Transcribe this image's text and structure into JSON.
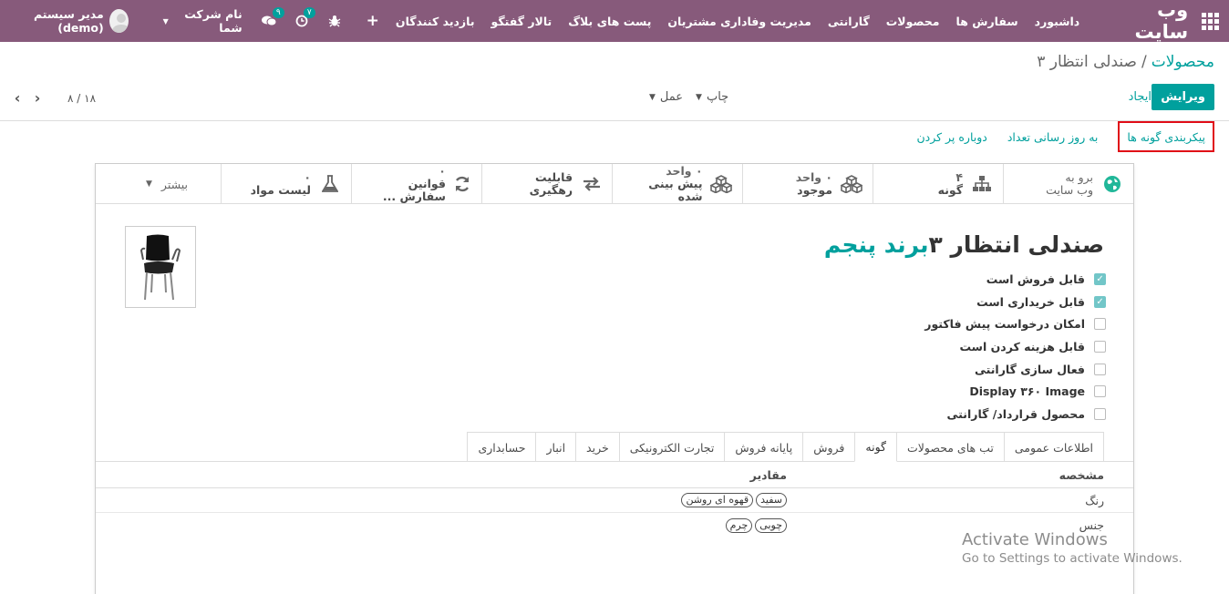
{
  "navbar": {
    "brand": "وب سایت",
    "menu": [
      "داشبورد",
      "سفارش ها",
      "محصولات",
      "گارانتی",
      "مدیریت وفاداری مشتریان",
      "پست های بلاگ",
      "تالار گفتگو",
      "بازدید کنندگان"
    ],
    "plus": "+",
    "activity_badge": "۷",
    "messages_badge": "۹",
    "company": "نام شرکت شما",
    "user": "مدیر سیستم (demo)",
    "colors": {
      "bar": "#875a7b",
      "badge": "#00a09d"
    }
  },
  "breadcrumb": {
    "parent": "محصولات",
    "separator": "/",
    "current": "صندلی انتظار ۳"
  },
  "control": {
    "edit": "ویرایش",
    "create": "ایجاد",
    "print": "چاپ",
    "action": "عمل",
    "pager_value": "۸ / ۱۸"
  },
  "statusbar": {
    "configure_variants": "پیکربندی گونه ها",
    "update_qty": "به روز رسانی تعداد",
    "replenish": "دوباره پر کردن"
  },
  "smart_buttons": {
    "website": {
      "line1": "برو به",
      "line2": "وب سایت",
      "icon": "globe-icon"
    },
    "variants": {
      "num": "۴",
      "label": "گونه",
      "icon": "sitemap-icon"
    },
    "on_hand": {
      "num": "۰ واحد",
      "label": "موجود",
      "icon": "cubes-icon"
    },
    "forecasted": {
      "num": "۰ واحد",
      "label": "پیش بینی شده",
      "icon": "cubes-icon"
    },
    "traceability": {
      "label": "قابلیت رهگیری",
      "icon": "exchange-icon"
    },
    "reordering": {
      "num": "۰",
      "label": "قوانین سفارش ...",
      "icon": "refresh-icon"
    },
    "bom": {
      "num": "۰",
      "label": "لیست مواد",
      "icon": "flask-icon"
    },
    "more": "بیشتر"
  },
  "product": {
    "name": "صندلی انتظار ۳",
    "brand": "برند پنجم",
    "image": "chair-image"
  },
  "checkboxes": [
    {
      "label": "قابل فروش است",
      "checked": true
    },
    {
      "label": "قابل خریداری است",
      "checked": true
    },
    {
      "label": "امکان درخواست پیش فاکتور",
      "checked": false
    },
    {
      "label": "قابل هزینه کردن است",
      "checked": false
    },
    {
      "label": "فعال سازی گارانتی",
      "checked": false
    },
    {
      "label": "Display ۳۶۰ Image",
      "checked": false
    },
    {
      "label": "محصول قرارداد/ گارانتی",
      "checked": false
    }
  ],
  "tabs": [
    "اطلاعات عمومی",
    "تب های محصولات",
    "گونه",
    "فروش",
    "پایانه فروش",
    "تجارت الکترونیکی",
    "خرید",
    "انبار",
    "حسابداری"
  ],
  "active_tab": "گونه",
  "attributes": {
    "header_attr": "مشخصه",
    "header_vals": "مقادیر",
    "rows": [
      {
        "attr": "رنگ",
        "values": [
          "سفید",
          "قهوه ای روشن"
        ]
      },
      {
        "attr": "جنس",
        "values": [
          "چوبی",
          "چرم"
        ]
      }
    ]
  },
  "watermark": {
    "line1": "Activate Windows",
    "line2": "Go to Settings to activate Windows."
  },
  "accent": "#00a09d"
}
